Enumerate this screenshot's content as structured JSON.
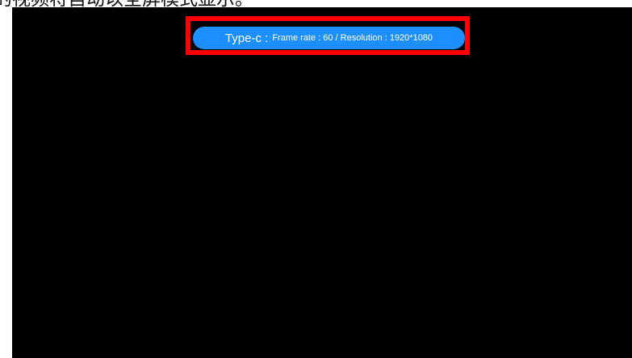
{
  "caption": {
    "text": "的视频将自动以全屏模式显示。"
  },
  "status_bar": {
    "source": "Type-c :",
    "details": "Frame rate : 60 / Resolution : 1920*1080",
    "pill_color": "#1e8fff",
    "highlight_color": "#ff0000"
  },
  "screen": {
    "background_color": "#000000"
  }
}
